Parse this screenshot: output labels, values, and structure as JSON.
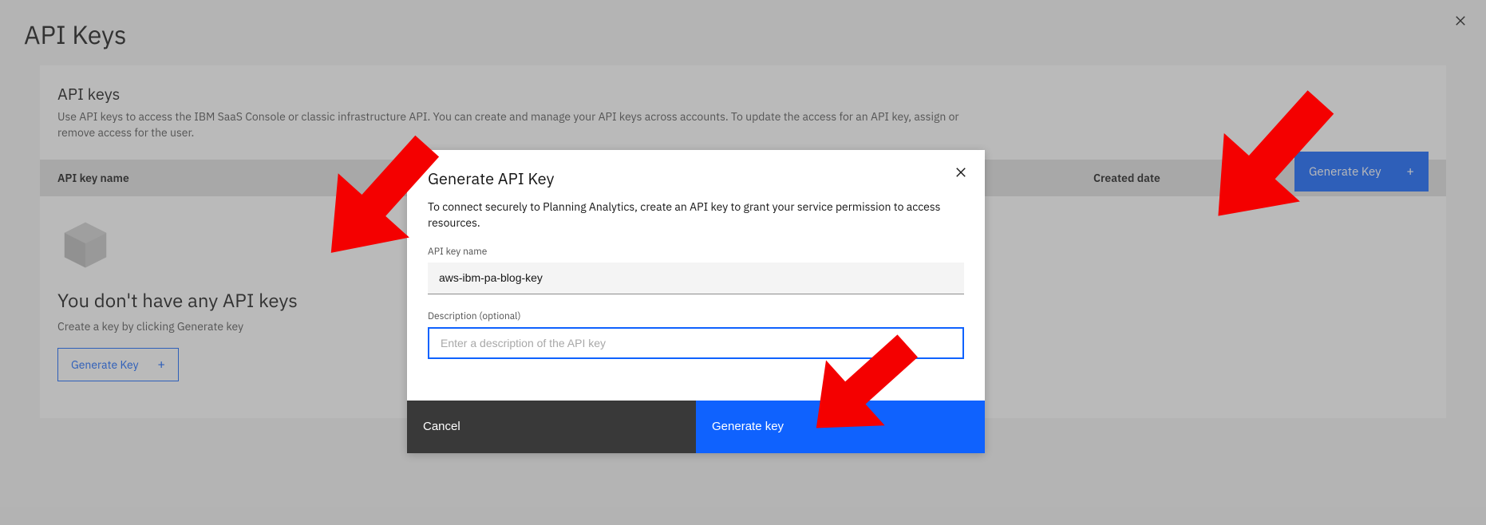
{
  "page": {
    "title": "API Keys"
  },
  "card": {
    "title": "API keys",
    "subtitle": "Use API keys to access the IBM SaaS Console or classic infrastructure API. You can create and manage your API keys across accounts. To update the access for an API key, assign or remove access for the user.",
    "generate_button": "Generate Key",
    "plus": "+"
  },
  "table": {
    "col_name": "API key name",
    "col_date": "Created date"
  },
  "empty": {
    "title": "You don't have any API keys",
    "subtitle": "Create a key by clicking Generate key",
    "button": "Generate Key",
    "plus": "+"
  },
  "modal": {
    "title": "Generate API Key",
    "description": "To connect securely to Planning Analytics, create an API key to grant your service permission to access resources.",
    "name_label": "API key name",
    "name_value": "aws-ibm-pa-blog-key",
    "desc_label": "Description (optional)",
    "desc_placeholder": "Enter a description of the API key",
    "cancel": "Cancel",
    "generate": "Generate key"
  }
}
